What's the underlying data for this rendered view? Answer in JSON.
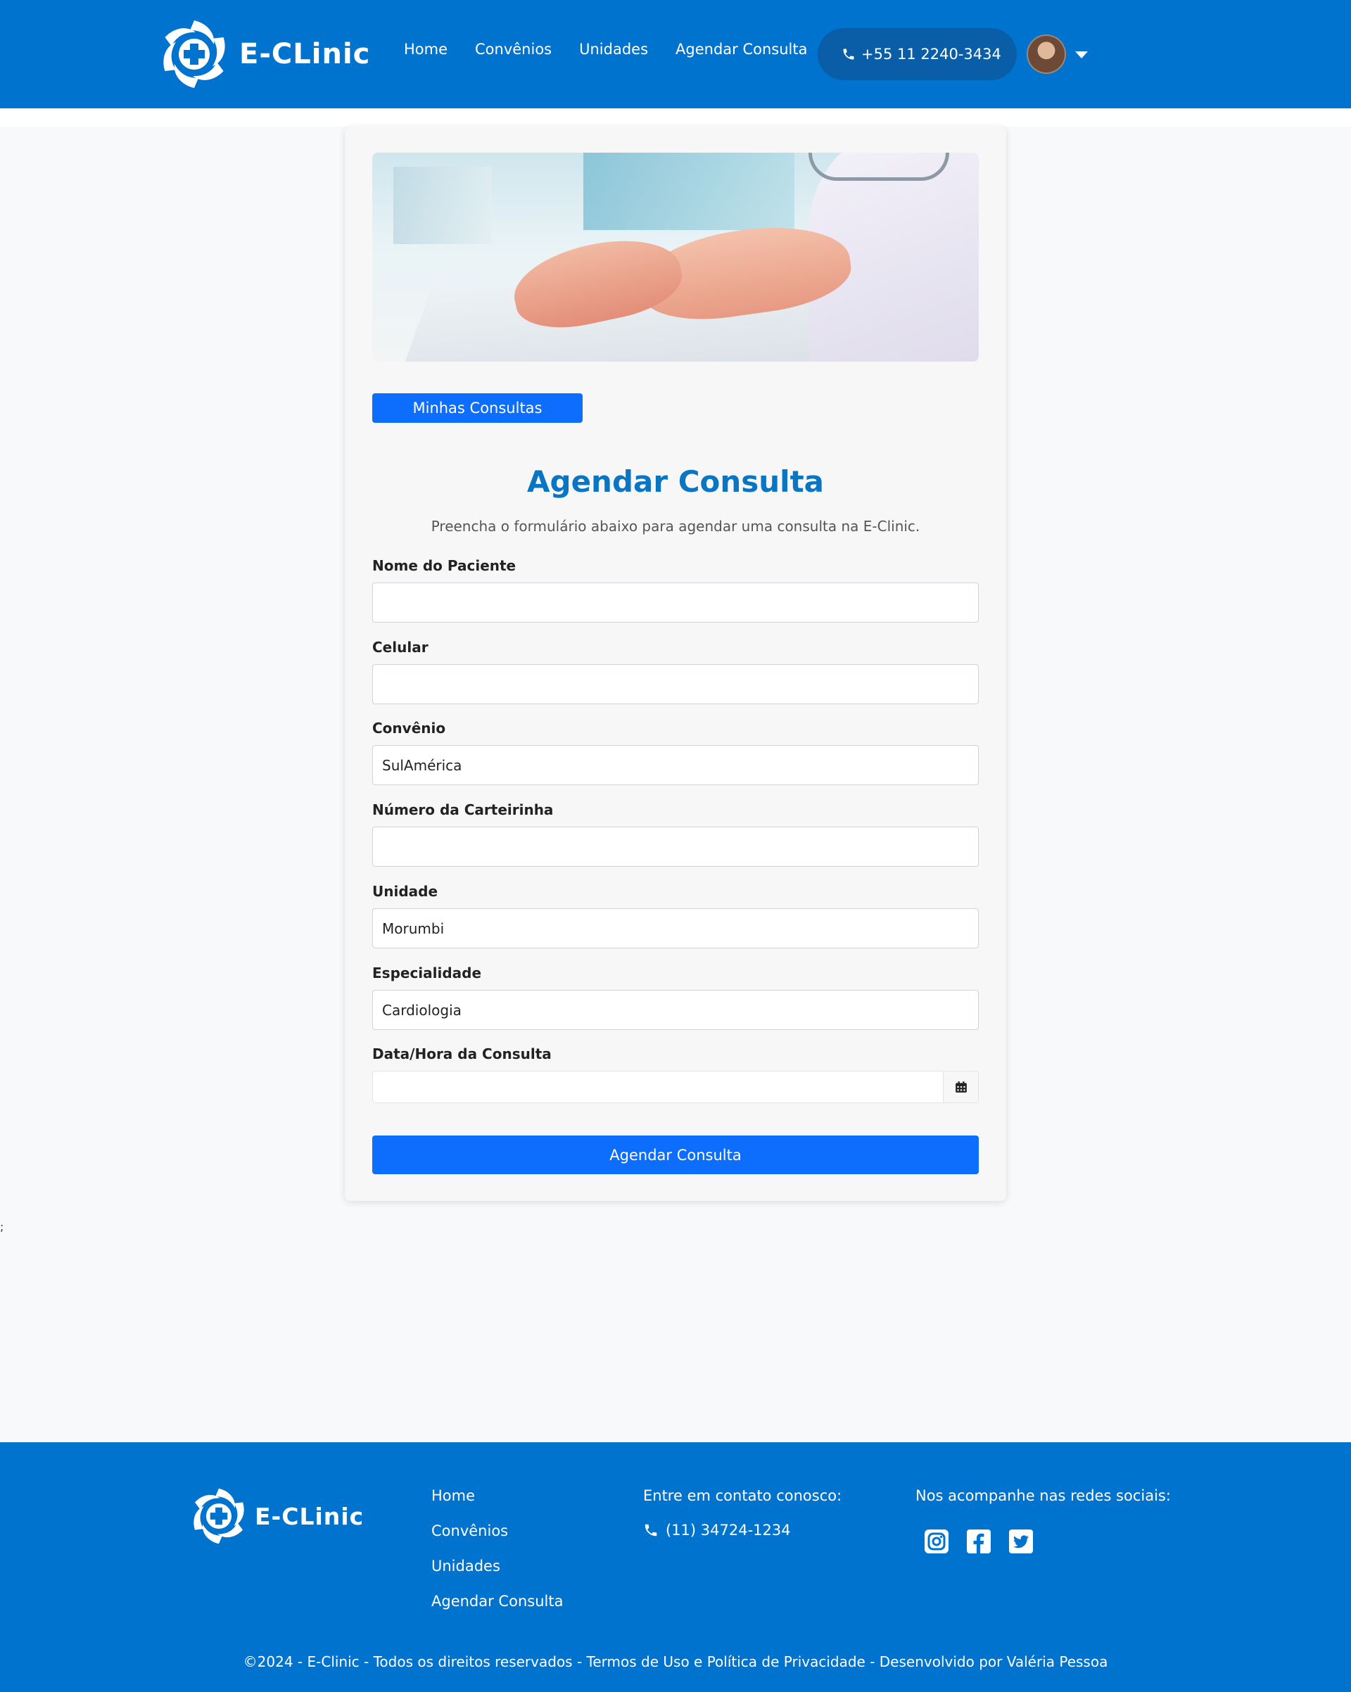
{
  "header": {
    "brand": "E-CLinic",
    "nav": [
      "Home",
      "Convênios",
      "Unidades",
      "Agendar Consulta"
    ],
    "phone": "+55 11 2240-3434"
  },
  "card": {
    "my_appointments_button": "Minhas Consultas",
    "title": "Agendar Consulta",
    "subtitle": "Preencha o formulário abaixo para agendar uma consulta na E-Clinic.",
    "fields": [
      {
        "label": "Nome do Paciente",
        "value": ""
      },
      {
        "label": "Celular",
        "value": ""
      },
      {
        "label": "Convênio",
        "value": "SulAmérica"
      },
      {
        "label": "Número da Carteirinha",
        "value": ""
      },
      {
        "label": "Unidade",
        "value": "Morumbi"
      },
      {
        "label": "Especialidade",
        "value": "Cardiologia"
      },
      {
        "label": "Data/Hora da Consulta",
        "value": ""
      }
    ],
    "submit_button": "Agendar Consulta"
  },
  "stray_text": ";",
  "footer": {
    "brand": "E-CLinic",
    "links": [
      "Home",
      "Convênios",
      "Unidades",
      "Agendar Consulta"
    ],
    "contact_title": "Entre em contato conosco:",
    "contact_phone": "(11) 34724-1234",
    "social_title": "Nos acompanhe nas redes sociais:",
    "social_icons": [
      "instagram-icon",
      "facebook-icon",
      "twitter-icon"
    ],
    "copyright": "©2024 - E-Clinic - Todos os direitos reservados - Termos de Uso e Política de Privacidade - Desenvolvido por Valéria Pessoa"
  },
  "colors": {
    "brand_blue": "#0073cf",
    "button_blue": "#0d6efd",
    "title_blue": "#0a75c2"
  }
}
